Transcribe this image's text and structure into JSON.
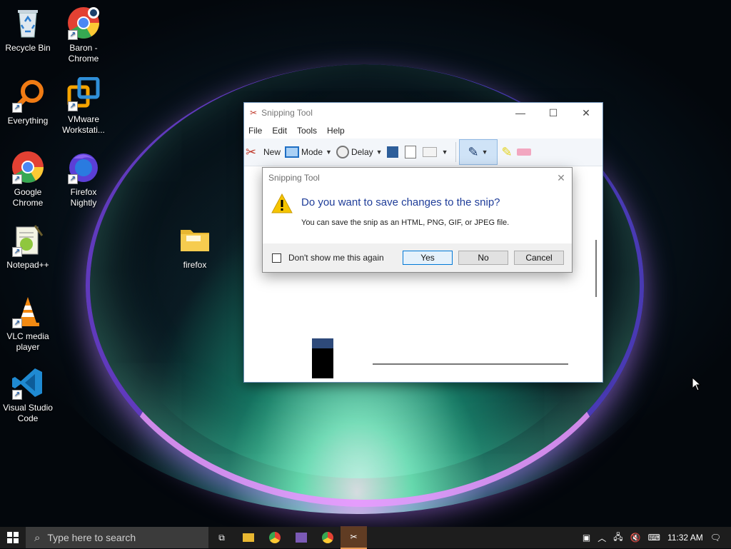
{
  "desktop": {
    "icons": [
      {
        "label": "Recycle Bin"
      },
      {
        "label": "Baron -\nChrome"
      },
      {
        "label": "Everything"
      },
      {
        "label": "VMware\nWorkstati..."
      },
      {
        "label": "Google\nChrome"
      },
      {
        "label": "Firefox\nNightly"
      },
      {
        "label": "Notepad++"
      },
      {
        "label": "firefox"
      },
      {
        "label": "VLC media\nplayer"
      },
      {
        "label": "Visual Studio\nCode"
      }
    ]
  },
  "snipping_tool": {
    "title": "Snipping Tool",
    "menu": [
      "File",
      "Edit",
      "Tools",
      "Help"
    ],
    "toolbar": {
      "new": "New",
      "mode": "Mode",
      "delay": "Delay"
    }
  },
  "dialog": {
    "title": "Snipping Tool",
    "question": "Do you want to save changes to the snip?",
    "detail": "You can save the snip as an HTML, PNG, GIF, or JPEG file.",
    "checkbox_label": "Don't show me this again",
    "checkbox_checked": false,
    "yes": "Yes",
    "no": "No",
    "cancel": "Cancel"
  },
  "taskbar": {
    "search_placeholder": "Type here to search",
    "clock": "11:32 AM"
  },
  "colors": {
    "accent": "#0078d7",
    "taskbar": "#1d1d1d"
  }
}
